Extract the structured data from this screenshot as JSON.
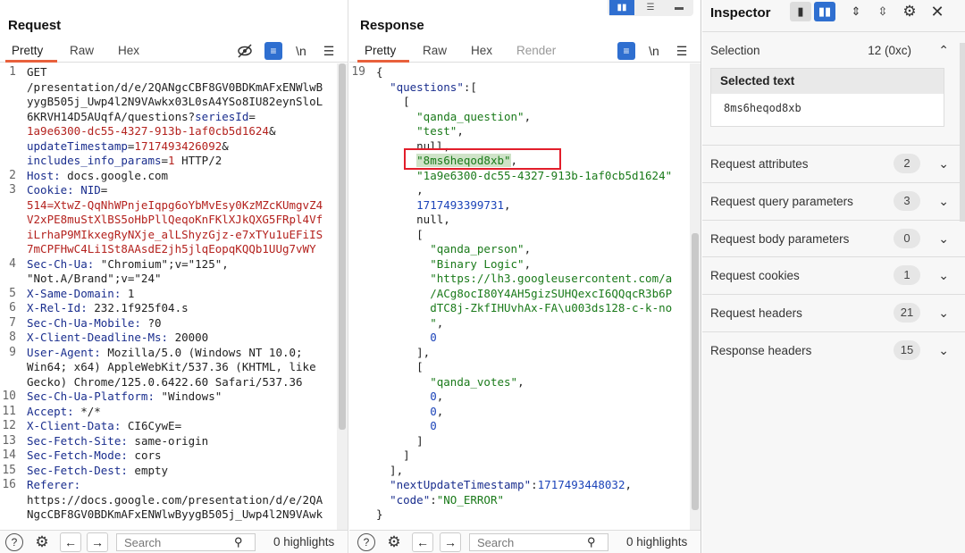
{
  "request": {
    "title": "Request",
    "tabs": [
      {
        "label": "Pretty"
      },
      {
        "label": "Raw"
      },
      {
        "label": "Hex"
      }
    ],
    "tool_newline": "\\n",
    "lines": [
      {
        "no": "1",
        "parts": [
          {
            "c": "p",
            "t": "GET"
          }
        ]
      },
      {
        "no": "",
        "parts": [
          {
            "c": "p",
            "t": "/presentation/d/e/2QANgcCBF8GV0BDKmAFxENWlwB"
          }
        ]
      },
      {
        "no": "",
        "parts": [
          {
            "c": "p",
            "t": "yygB505j_Uwp4l2N9VAwkx03L0sA4YSo8IU82eynSloL"
          }
        ]
      },
      {
        "no": "",
        "parts": [
          {
            "c": "p",
            "t": "6KRVH14D5AUqfA/questions?"
          },
          {
            "c": "k",
            "t": "seriesId"
          },
          {
            "c": "p",
            "t": "="
          }
        ]
      },
      {
        "no": "",
        "parts": [
          {
            "c": "v",
            "t": "1a9e6300-dc55-4327-913b-1af0cb5d1624"
          },
          {
            "c": "p",
            "t": "&"
          }
        ]
      },
      {
        "no": "",
        "parts": [
          {
            "c": "k",
            "t": "updateTimestamp"
          },
          {
            "c": "p",
            "t": "="
          },
          {
            "c": "v",
            "t": "1717493426092"
          },
          {
            "c": "p",
            "t": "&"
          }
        ]
      },
      {
        "no": "",
        "parts": [
          {
            "c": "k",
            "t": "includes_info_params"
          },
          {
            "c": "p",
            "t": "="
          },
          {
            "c": "v",
            "t": "1"
          },
          {
            "c": "p",
            "t": " HTTP/2"
          }
        ]
      },
      {
        "no": "2",
        "parts": [
          {
            "c": "k",
            "t": "Host: "
          },
          {
            "c": "p",
            "t": "docs.google.com"
          }
        ]
      },
      {
        "no": "3",
        "parts": [
          {
            "c": "k",
            "t": "Cookie: NID"
          },
          {
            "c": "p",
            "t": "="
          }
        ]
      },
      {
        "no": "",
        "parts": [
          {
            "c": "v",
            "t": "514=XtwZ-QqNhWPnjeIqpg6oYbMvEsy0KzMZcKUmgvZ4"
          }
        ]
      },
      {
        "no": "",
        "parts": [
          {
            "c": "v",
            "t": "V2xPE8muStXlBS5oHbPllQeqoKnFKlXJkQXG5FRpl4Vf"
          }
        ]
      },
      {
        "no": "",
        "parts": [
          {
            "c": "v",
            "t": "iLrhaP9MIkxegRyNXje_alLShyzGjz-e7xTYu1uEFiIS"
          }
        ]
      },
      {
        "no": "",
        "parts": [
          {
            "c": "v",
            "t": "7mCPFHwC4Li1St8AAsdE2jh5jlqEopqKQQb1UUg7vWY"
          }
        ]
      },
      {
        "no": "4",
        "parts": [
          {
            "c": "k",
            "t": "Sec-Ch-Ua: "
          },
          {
            "c": "p",
            "t": "\"Chromium\";v=\"125\","
          }
        ]
      },
      {
        "no": "",
        "parts": [
          {
            "c": "p",
            "t": "\"Not.A/Brand\";v=\"24\""
          }
        ]
      },
      {
        "no": "5",
        "parts": [
          {
            "c": "k",
            "t": "X-Same-Domain: "
          },
          {
            "c": "p",
            "t": "1"
          }
        ]
      },
      {
        "no": "6",
        "parts": [
          {
            "c": "k",
            "t": "X-Rel-Id: "
          },
          {
            "c": "p",
            "t": "232.1f925f04.s"
          }
        ]
      },
      {
        "no": "7",
        "parts": [
          {
            "c": "k",
            "t": "Sec-Ch-Ua-Mobile: "
          },
          {
            "c": "p",
            "t": "?0"
          }
        ]
      },
      {
        "no": "8",
        "parts": [
          {
            "c": "k",
            "t": "X-Client-Deadline-Ms: "
          },
          {
            "c": "p",
            "t": "20000"
          }
        ]
      },
      {
        "no": "9",
        "parts": [
          {
            "c": "k",
            "t": "User-Agent: "
          },
          {
            "c": "p",
            "t": "Mozilla/5.0 (Windows NT 10.0;"
          }
        ]
      },
      {
        "no": "",
        "parts": [
          {
            "c": "p",
            "t": "Win64; x64) AppleWebKit/537.36 (KHTML, like"
          }
        ]
      },
      {
        "no": "",
        "parts": [
          {
            "c": "p",
            "t": "Gecko) Chrome/125.0.6422.60 Safari/537.36"
          }
        ]
      },
      {
        "no": "10",
        "parts": [
          {
            "c": "k",
            "t": "Sec-Ch-Ua-Platform: "
          },
          {
            "c": "p",
            "t": "\"Windows\""
          }
        ]
      },
      {
        "no": "11",
        "parts": [
          {
            "c": "k",
            "t": "Accept: "
          },
          {
            "c": "p",
            "t": "*/*"
          }
        ]
      },
      {
        "no": "12",
        "parts": [
          {
            "c": "k",
            "t": "X-Client-Data: "
          },
          {
            "c": "p",
            "t": "CI6CywE="
          }
        ]
      },
      {
        "no": "13",
        "parts": [
          {
            "c": "k",
            "t": "Sec-Fetch-Site: "
          },
          {
            "c": "p",
            "t": "same-origin"
          }
        ]
      },
      {
        "no": "14",
        "parts": [
          {
            "c": "k",
            "t": "Sec-Fetch-Mode: "
          },
          {
            "c": "p",
            "t": "cors"
          }
        ]
      },
      {
        "no": "15",
        "parts": [
          {
            "c": "k",
            "t": "Sec-Fetch-Dest: "
          },
          {
            "c": "p",
            "t": "empty"
          }
        ]
      },
      {
        "no": "16",
        "parts": [
          {
            "c": "k",
            "t": "Referer: "
          }
        ]
      },
      {
        "no": "",
        "parts": [
          {
            "c": "p",
            "t": "https://docs.google.com/presentation/d/e/2QA"
          }
        ]
      },
      {
        "no": "",
        "parts": [
          {
            "c": "p",
            "t": "NgcCBF8GV0BDKmAFxENWlwByygB505j_Uwp4l2N9VAwk"
          }
        ]
      }
    ],
    "search_placeholder": "Search",
    "highlights": "0 highlights"
  },
  "response": {
    "title": "Response",
    "tabs": [
      {
        "label": "Pretty"
      },
      {
        "label": "Raw"
      },
      {
        "label": "Hex"
      },
      {
        "label": "Render"
      }
    ],
    "tool_newline": "\\n",
    "lines": [
      {
        "no": "19",
        "parts": [
          {
            "c": "p",
            "t": "{"
          }
        ]
      },
      {
        "no": "",
        "parts": [
          {
            "c": "p",
            "t": "  "
          },
          {
            "c": "k",
            "t": "\"questions\""
          },
          {
            "c": "p",
            "t": ":["
          }
        ]
      },
      {
        "no": "",
        "parts": [
          {
            "c": "p",
            "t": "    ["
          }
        ]
      },
      {
        "no": "",
        "parts": [
          {
            "c": "p",
            "t": "      "
          },
          {
            "c": "s",
            "t": "\"qanda_question\""
          },
          {
            "c": "p",
            "t": ","
          }
        ]
      },
      {
        "no": "",
        "parts": [
          {
            "c": "p",
            "t": "      "
          },
          {
            "c": "s",
            "t": "\"test\""
          },
          {
            "c": "p",
            "t": ","
          }
        ]
      },
      {
        "no": "",
        "parts": [
          {
            "c": "p",
            "t": "      null,"
          }
        ]
      },
      {
        "no": "",
        "parts": [
          {
            "c": "p",
            "t": "      "
          },
          {
            "c": "s",
            "t": "\"8ms6heqod8xb\""
          },
          {
            "c": "p",
            "t": ","
          }
        ]
      },
      {
        "no": "",
        "parts": [
          {
            "c": "p",
            "t": "      "
          },
          {
            "c": "s",
            "t": "\"1a9e6300-dc55-4327-913b-1af0cb5d1624\""
          }
        ]
      },
      {
        "no": "",
        "parts": [
          {
            "c": "p",
            "t": "      ,"
          }
        ]
      },
      {
        "no": "",
        "parts": [
          {
            "c": "p",
            "t": "      "
          },
          {
            "c": "n",
            "t": "1717493399731"
          },
          {
            "c": "p",
            "t": ","
          }
        ]
      },
      {
        "no": "",
        "parts": [
          {
            "c": "p",
            "t": "      null,"
          }
        ]
      },
      {
        "no": "",
        "parts": [
          {
            "c": "p",
            "t": "      ["
          }
        ]
      },
      {
        "no": "",
        "parts": [
          {
            "c": "p",
            "t": "        "
          },
          {
            "c": "s",
            "t": "\"qanda_person\""
          },
          {
            "c": "p",
            "t": ","
          }
        ]
      },
      {
        "no": "",
        "parts": [
          {
            "c": "p",
            "t": "        "
          },
          {
            "c": "s",
            "t": "\"Binary Logic\""
          },
          {
            "c": "p",
            "t": ","
          }
        ]
      },
      {
        "no": "",
        "parts": [
          {
            "c": "p",
            "t": "        "
          },
          {
            "c": "s",
            "t": "\"https://lh3.googleusercontent.com/a"
          }
        ]
      },
      {
        "no": "",
        "parts": [
          {
            "c": "p",
            "t": "        "
          },
          {
            "c": "s",
            "t": "/ACg8ocI80Y4AH5gizSUHQexcI6QQqcR3b6P"
          }
        ]
      },
      {
        "no": "",
        "parts": [
          {
            "c": "p",
            "t": "        "
          },
          {
            "c": "s",
            "t": "dTC8j-ZkfIHUvhAx-FA\\u003ds128-c-k-no"
          }
        ]
      },
      {
        "no": "",
        "parts": [
          {
            "c": "p",
            "t": "        "
          },
          {
            "c": "s",
            "t": "\""
          },
          {
            "c": "p",
            "t": ","
          }
        ]
      },
      {
        "no": "",
        "parts": [
          {
            "c": "p",
            "t": "        "
          },
          {
            "c": "n",
            "t": "0"
          }
        ]
      },
      {
        "no": "",
        "parts": [
          {
            "c": "p",
            "t": "      ],"
          }
        ]
      },
      {
        "no": "",
        "parts": [
          {
            "c": "p",
            "t": "      ["
          }
        ]
      },
      {
        "no": "",
        "parts": [
          {
            "c": "p",
            "t": "        "
          },
          {
            "c": "s",
            "t": "\"qanda_votes\""
          },
          {
            "c": "p",
            "t": ","
          }
        ]
      },
      {
        "no": "",
        "parts": [
          {
            "c": "p",
            "t": "        "
          },
          {
            "c": "n",
            "t": "0"
          },
          {
            "c": "p",
            "t": ","
          }
        ]
      },
      {
        "no": "",
        "parts": [
          {
            "c": "p",
            "t": "        "
          },
          {
            "c": "n",
            "t": "0"
          },
          {
            "c": "p",
            "t": ","
          }
        ]
      },
      {
        "no": "",
        "parts": [
          {
            "c": "p",
            "t": "        "
          },
          {
            "c": "n",
            "t": "0"
          }
        ]
      },
      {
        "no": "",
        "parts": [
          {
            "c": "p",
            "t": "      ]"
          }
        ]
      },
      {
        "no": "",
        "parts": [
          {
            "c": "p",
            "t": "    ]"
          }
        ]
      },
      {
        "no": "",
        "parts": [
          {
            "c": "p",
            "t": "  ],"
          }
        ]
      },
      {
        "no": "",
        "parts": [
          {
            "c": "p",
            "t": "  "
          },
          {
            "c": "k",
            "t": "\"nextUpdateTimestamp\""
          },
          {
            "c": "p",
            "t": ":"
          },
          {
            "c": "n",
            "t": "1717493448032"
          },
          {
            "c": "p",
            "t": ","
          }
        ]
      },
      {
        "no": "",
        "parts": [
          {
            "c": "p",
            "t": "  "
          },
          {
            "c": "k",
            "t": "\"code\""
          },
          {
            "c": "p",
            "t": ":"
          },
          {
            "c": "s",
            "t": "\"NO_ERROR\""
          }
        ]
      },
      {
        "no": "",
        "parts": [
          {
            "c": "p",
            "t": "}"
          }
        ]
      }
    ],
    "search_placeholder": "Search",
    "highlights": "0 highlights"
  },
  "inspector": {
    "title": "Inspector",
    "selection_label": "Selection",
    "selection_count": "12 (0xc)",
    "selected_text_header": "Selected text",
    "selected_text_value": "8ms6heqod8xb",
    "rows": [
      {
        "label": "Request attributes",
        "count": "2"
      },
      {
        "label": "Request query parameters",
        "count": "3"
      },
      {
        "label": "Request body parameters",
        "count": "0"
      },
      {
        "label": "Request cookies",
        "count": "1"
      },
      {
        "label": "Request headers",
        "count": "21"
      },
      {
        "label": "Response headers",
        "count": "15"
      }
    ]
  },
  "colors": {
    "accent": "#2f6fd0",
    "tab_underline": "#e8603c",
    "highlight_box": "#e21e2b"
  }
}
